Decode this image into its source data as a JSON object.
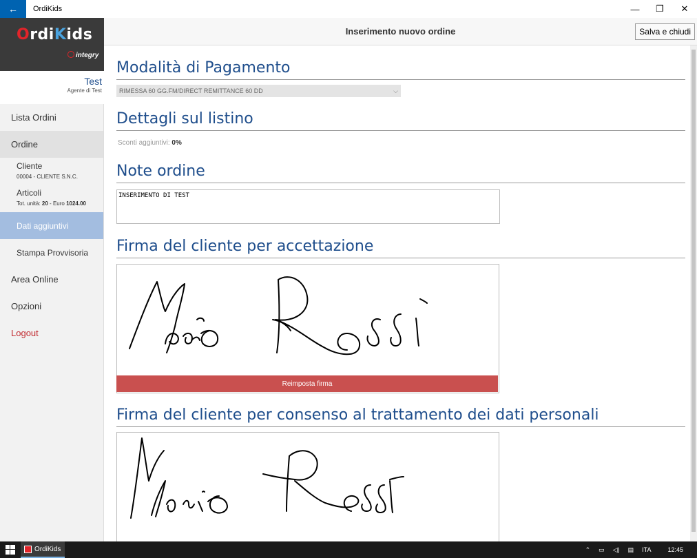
{
  "window": {
    "app_title": "OrdiKids",
    "back_glyph": "←",
    "minimize_glyph": "—",
    "restore_glyph": "❐",
    "close_glyph": "✕"
  },
  "sidebar": {
    "logo_sub": "integry",
    "user_name": "Test",
    "user_role": "Agente di Test",
    "nav": {
      "lista_ordini": "Lista Ordini",
      "ordine": "Ordine",
      "cliente": "Cliente",
      "cliente_detail": "00004 - CLIENTE S.N.C.",
      "articoli": "Articoli",
      "articoli_detail_prefix": "Tot. unità: ",
      "articoli_units": "20",
      "articoli_detail_mid": " - Euro ",
      "articoli_euro": "1024.00",
      "dati_aggiuntivi": "Dati aggiuntivi",
      "stampa_provvisoria": "Stampa Provvisoria",
      "area_online": "Area Online",
      "opzioni": "Opzioni",
      "logout": "Logout"
    }
  },
  "header": {
    "title": "Inserimento nuovo ordine",
    "save_label": "Salva e chiudi"
  },
  "main": {
    "payment_title": "Modalità di Pagamento",
    "payment_value": "RIMESSA 60 GG.FM/DIRECT REMITTANCE 60 DD",
    "listino_title": "Dettagli sul listino",
    "sconti_label": "Sconti aggiuntivi: ",
    "sconti_value": "0%",
    "note_title": "Note ordine",
    "note_value": "INSERIMENTO DI TEST",
    "firma1_title": "Firma del cliente per accettazione",
    "reset_label": "Reimposta firma",
    "firma2_title": "Firma del cliente per consenso al trattamento dei dati personali"
  },
  "taskbar": {
    "app_label": "OrdiKids",
    "lang": "ITA",
    "time": "12:45"
  },
  "colors": {
    "accent_blue": "#1f4e8c",
    "titlebar_back": "#0063b1",
    "selected_nav": "#a3bde0",
    "reset_button": "#c9504f",
    "logout_red": "#c0282d"
  }
}
